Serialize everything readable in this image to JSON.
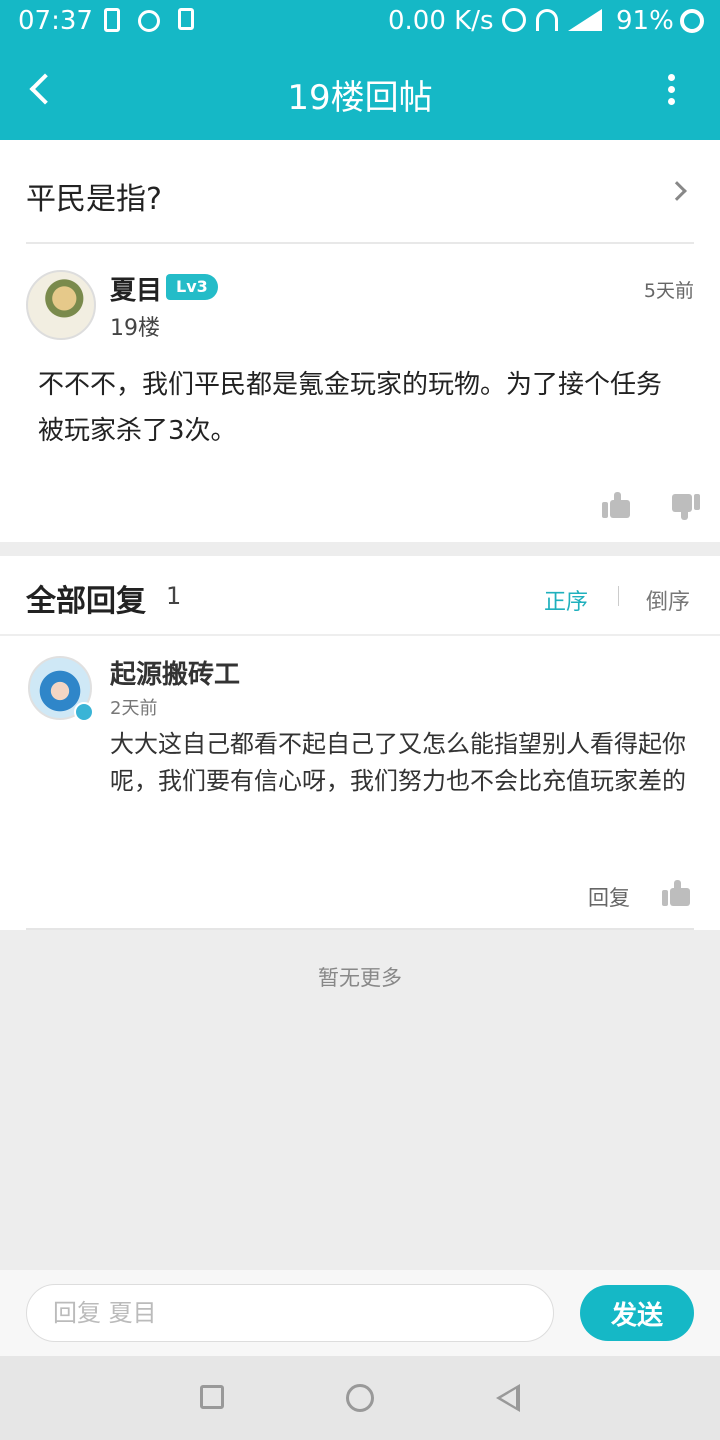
{
  "status_bar": {
    "time": "07:37",
    "net_speed": "0.00 K/s",
    "battery_pct": "91%",
    "icons": [
      "battery-charging-icon",
      "timer-icon",
      "download-icon",
      "alarm-icon",
      "headset-icon",
      "signal-icon",
      "battery-ring-icon"
    ]
  },
  "header": {
    "title": "19楼回帖",
    "back_icon": "back-chevron-icon",
    "more_icon": "more-vertical-icon"
  },
  "post": {
    "thread_title": "平民是指?",
    "author": "夏目",
    "level": "Lv3",
    "floor": "19楼",
    "time": "5天前",
    "content": "不不不，我们平民都是氪金玩家的玩物。为了接个任务被玩家杀了3次。"
  },
  "replies": {
    "title": "全部回复",
    "count": "1",
    "sort_asc": "正序",
    "sort_desc": "倒序",
    "items": [
      {
        "author": "起源搬砖工",
        "time": "2天前",
        "content": "大大这自己都看不起自己了又怎么能指望别人看得起你呢，我们要有信心呀，我们努力也不会比充值玩家差的",
        "reply_label": "回复"
      }
    ],
    "no_more": "暂无更多"
  },
  "input_bar": {
    "placeholder": "回复 夏目",
    "value": "",
    "send_label": "发送"
  },
  "colors": {
    "accent": "#15b8c6",
    "level_badge": "#24bcc8",
    "sort_active": "#1fb0bd"
  }
}
